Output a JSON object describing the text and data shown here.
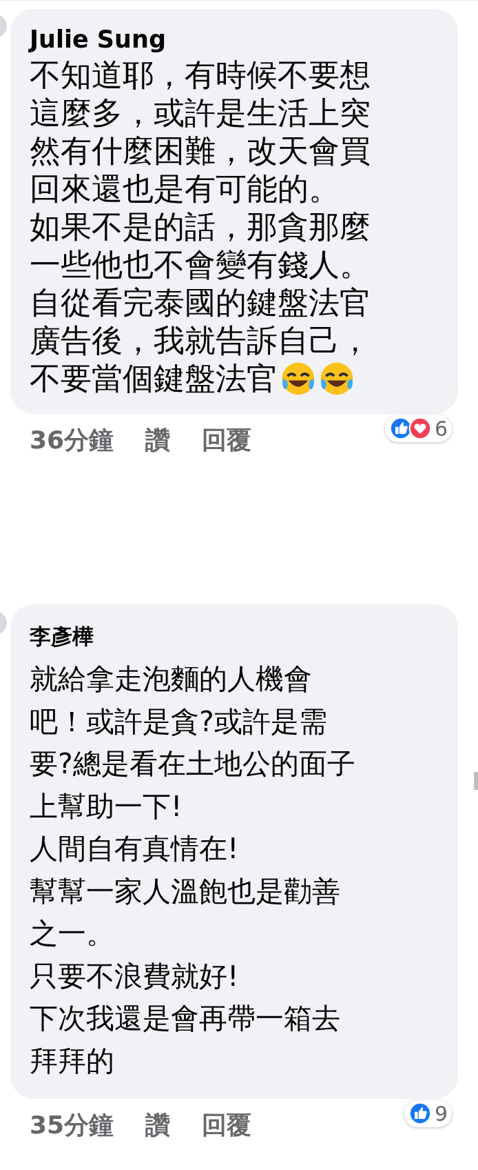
{
  "comments": [
    {
      "author": "Julie Sung",
      "lines": [
        "不知道耶，有時候不要想",
        "這麼多，或許是生活上突",
        "然有什麼困難，改天會買",
        "回來還也是有可能的。",
        "如果不是的話，那貪那麼",
        "一些他也不會變有錢人。",
        "自從看完泰國的鍵盤法官",
        "廣告後，我就告訴自己，",
        "不要當個鍵盤法官"
      ],
      "trailing_icons": [
        {
          "kind": "laughing"
        },
        {
          "kind": "laughing"
        }
      ],
      "time": "36分鐘",
      "actions": [
        "讚",
        "回覆"
      ],
      "reactions": [
        {
          "kind": "like"
        },
        {
          "kind": "love"
        }
      ],
      "reaction_count": "6"
    },
    {
      "author": "李彥樺",
      "lines": [
        "就給拿走泡麵的人機會",
        "吧！或許是貪?或許是需",
        "要?總是看在土地公的面子",
        "上幫助一下!",
        "人間自有真情在!",
        "幫幫一家人溫飽也是勸善",
        "之一。",
        "只要不浪費就好!",
        "下次我還是會再帶一箱去",
        "拜拜的"
      ],
      "time": "35分鐘",
      "actions": [
        "讚",
        "回覆"
      ],
      "reactions": [
        {
          "kind": "like"
        }
      ],
      "reaction_count": "9"
    }
  ]
}
